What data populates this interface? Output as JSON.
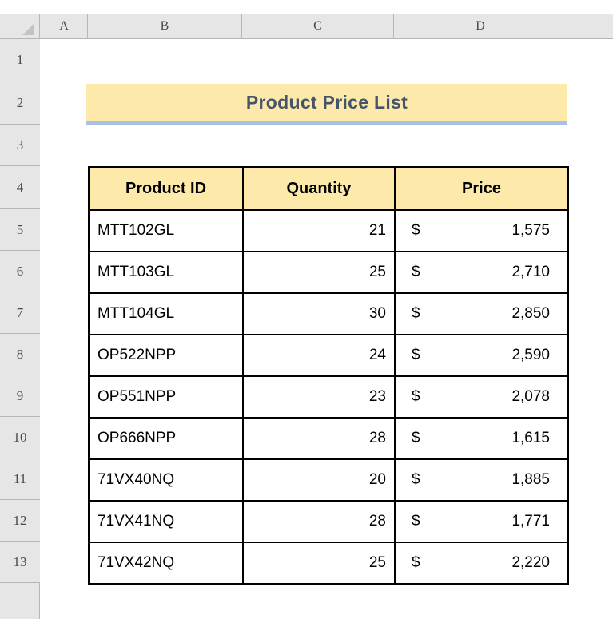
{
  "spreadsheet": {
    "column_headers": [
      "A",
      "B",
      "C",
      "D"
    ],
    "row_headers": [
      "1",
      "2",
      "3",
      "4",
      "5",
      "6",
      "7",
      "8",
      "9",
      "10",
      "11",
      "12",
      "13"
    ],
    "colors": {
      "title_background": "#fde9a9",
      "title_text": "#44546a",
      "title_underline": "#a8c0e4",
      "header_background": "#fde9a9",
      "border": "#000000",
      "gutter_background": "#e6e6e6"
    }
  },
  "title": {
    "text": "Product Price List"
  },
  "table": {
    "headers": [
      "Product ID",
      "Quantity",
      "Price"
    ],
    "currency_symbol": "$",
    "rows": [
      {
        "product_id": "MTT102GL",
        "quantity": "21",
        "price": "1,575"
      },
      {
        "product_id": "MTT103GL",
        "quantity": "25",
        "price": "2,710"
      },
      {
        "product_id": "MTT104GL",
        "quantity": "30",
        "price": "2,850"
      },
      {
        "product_id": "OP522NPP",
        "quantity": "24",
        "price": "2,590"
      },
      {
        "product_id": "OP551NPP",
        "quantity": "23",
        "price": "2,078"
      },
      {
        "product_id": "OP666NPP",
        "quantity": "28",
        "price": "1,615"
      },
      {
        "product_id": "71VX40NQ",
        "quantity": "20",
        "price": "1,885"
      },
      {
        "product_id": "71VX41NQ",
        "quantity": "28",
        "price": "1,771"
      },
      {
        "product_id": "71VX42NQ",
        "quantity": "25",
        "price": "2,220"
      }
    ]
  }
}
